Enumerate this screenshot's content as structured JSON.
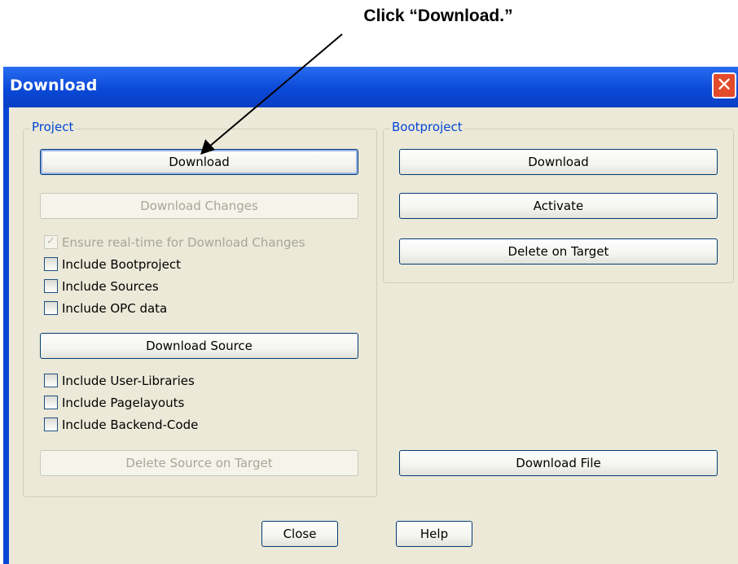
{
  "annotation": {
    "text": "Click “Download.”"
  },
  "window": {
    "title": "Download",
    "close_glyph": "✕"
  },
  "project": {
    "legend": "Project",
    "download_label": "Download",
    "download_changes_label": "Download Changes",
    "ensure_realtime_label": "Ensure real-time for Download Changes",
    "ensure_realtime_checked": true,
    "include_bootproject_label": "Include Bootproject",
    "include_sources_label": "Include Sources",
    "include_opc_label": "Include OPC data",
    "download_source_label": "Download Source",
    "include_user_libraries_label": "Include User-Libraries",
    "include_pagelayouts_label": "Include Pagelayouts",
    "include_backend_code_label": "Include Backend-Code",
    "delete_source_label": "Delete Source on Target"
  },
  "bootproject": {
    "legend": "Bootproject",
    "download_label": "Download",
    "activate_label": "Activate",
    "delete_label": "Delete on Target"
  },
  "download_file_label": "Download File",
  "footer": {
    "close_label": "Close",
    "help_label": "Help"
  },
  "icons": {
    "checkmark": "✓"
  }
}
